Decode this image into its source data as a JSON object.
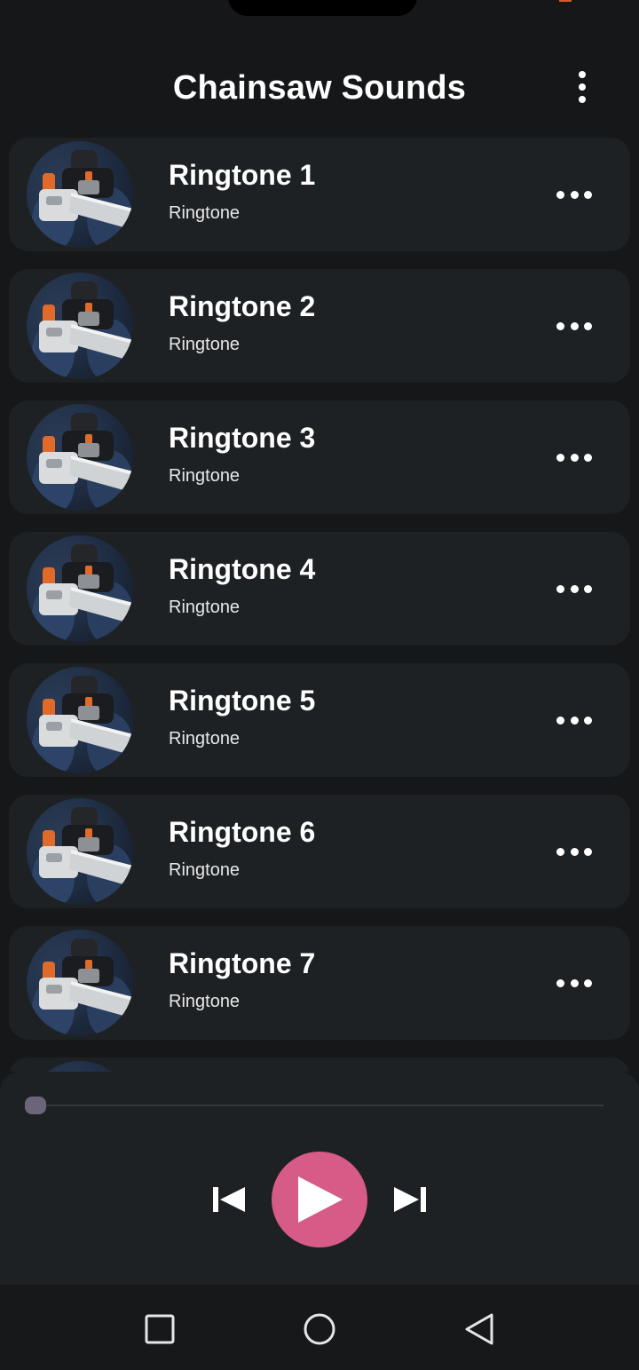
{
  "app": {
    "title": "Chainsaw Sounds",
    "menu_icon": "more-vertical-icon"
  },
  "ringtones": [
    {
      "title": "Ringtone 1",
      "subtitle": "Ringtone"
    },
    {
      "title": "Ringtone 2",
      "subtitle": "Ringtone"
    },
    {
      "title": "Ringtone 3",
      "subtitle": "Ringtone"
    },
    {
      "title": "Ringtone 4",
      "subtitle": "Ringtone"
    },
    {
      "title": "Ringtone 5",
      "subtitle": "Ringtone"
    },
    {
      "title": "Ringtone 6",
      "subtitle": "Ringtone"
    },
    {
      "title": "Ringtone 7",
      "subtitle": "Ringtone"
    }
  ],
  "player": {
    "progress": 0,
    "accent_color": "#d65b86",
    "knob_color": "#6c6579",
    "icons": [
      "skip-previous-icon",
      "play-icon",
      "skip-next-icon"
    ]
  },
  "system_nav": {
    "icons": [
      "recent-apps-icon",
      "home-icon",
      "back-icon"
    ]
  }
}
